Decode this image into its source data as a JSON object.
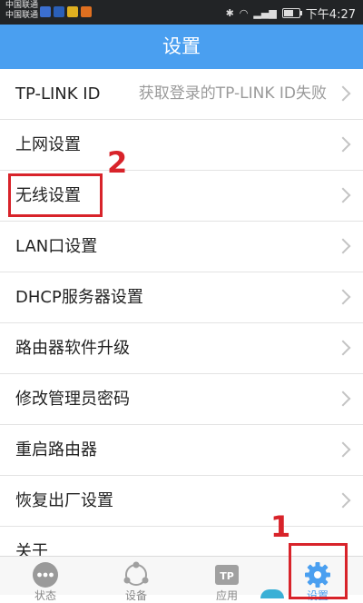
{
  "status_bar": {
    "carrier_1": "中国联通",
    "carrier_2": "中国联通",
    "time": "下午4:27",
    "bluetooth_icon": "bluetooth-icon",
    "wifi_icon": "wifi-icon",
    "signal_icon": "signal-icon",
    "battery_icon": "battery-icon",
    "notification_icon_colors": [
      "#3b6fd1",
      "#2a5fb8",
      "#e0b020",
      "#e07020"
    ]
  },
  "header": {
    "title": "设置"
  },
  "settings": {
    "items": [
      {
        "label": "TP-LINK ID",
        "value": "获取登录的TP-LINK ID失败"
      },
      {
        "label": "上网设置"
      },
      {
        "label": "无线设置"
      },
      {
        "label": "LAN口设置"
      },
      {
        "label": "DHCP服务器设置"
      },
      {
        "label": "路由器软件升级"
      },
      {
        "label": "修改管理员密码"
      },
      {
        "label": "重启路由器"
      },
      {
        "label": "恢复出厂设置"
      },
      {
        "label": "关于"
      }
    ]
  },
  "annotations": {
    "step_1": "1",
    "step_2": "2",
    "color": "#d8232a"
  },
  "tabbar": {
    "tabs": [
      {
        "label": "状态",
        "icon": "more-dots-icon"
      },
      {
        "label": "设备",
        "icon": "share-devices-icon"
      },
      {
        "label": "应用",
        "icon": "tp-app-icon",
        "icon_text": "TP"
      },
      {
        "label": "设置",
        "icon": "gear-icon",
        "active": true
      }
    ],
    "accent": "#4a9ff0"
  }
}
